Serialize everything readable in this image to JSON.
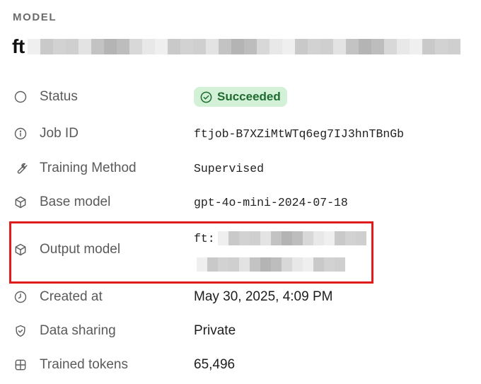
{
  "header": {
    "section_label": "MODEL",
    "model_prefix": "ft"
  },
  "details": {
    "status": {
      "label": "Status",
      "value": "Succeeded",
      "icon": "circle-icon",
      "badge_bg": "#d3f1d7",
      "badge_fg": "#1f6b30"
    },
    "job_id": {
      "label": "Job ID",
      "value": "ftjob-B7XZiMtWTq6eg7IJ3hnTBnGb",
      "icon": "info-icon"
    },
    "training_method": {
      "label": "Training Method",
      "value": "Supervised",
      "icon": "wrench-icon"
    },
    "base_model": {
      "label": "Base model",
      "value": "gpt-4o-mini-2024-07-18",
      "icon": "cube-icon"
    },
    "output_model": {
      "label": "Output model",
      "value_prefix": "ft:",
      "icon": "cube-icon",
      "highlight_color": "#e01b1b"
    },
    "created_at": {
      "label": "Created at",
      "value": "May 30, 2025, 4:09 PM",
      "icon": "clock-icon"
    },
    "data_sharing": {
      "label": "Data sharing",
      "value": "Private",
      "icon": "shield-check-icon"
    },
    "trained_tokens": {
      "label": "Trained tokens",
      "value": "65,496",
      "icon": "grid-icon"
    }
  }
}
